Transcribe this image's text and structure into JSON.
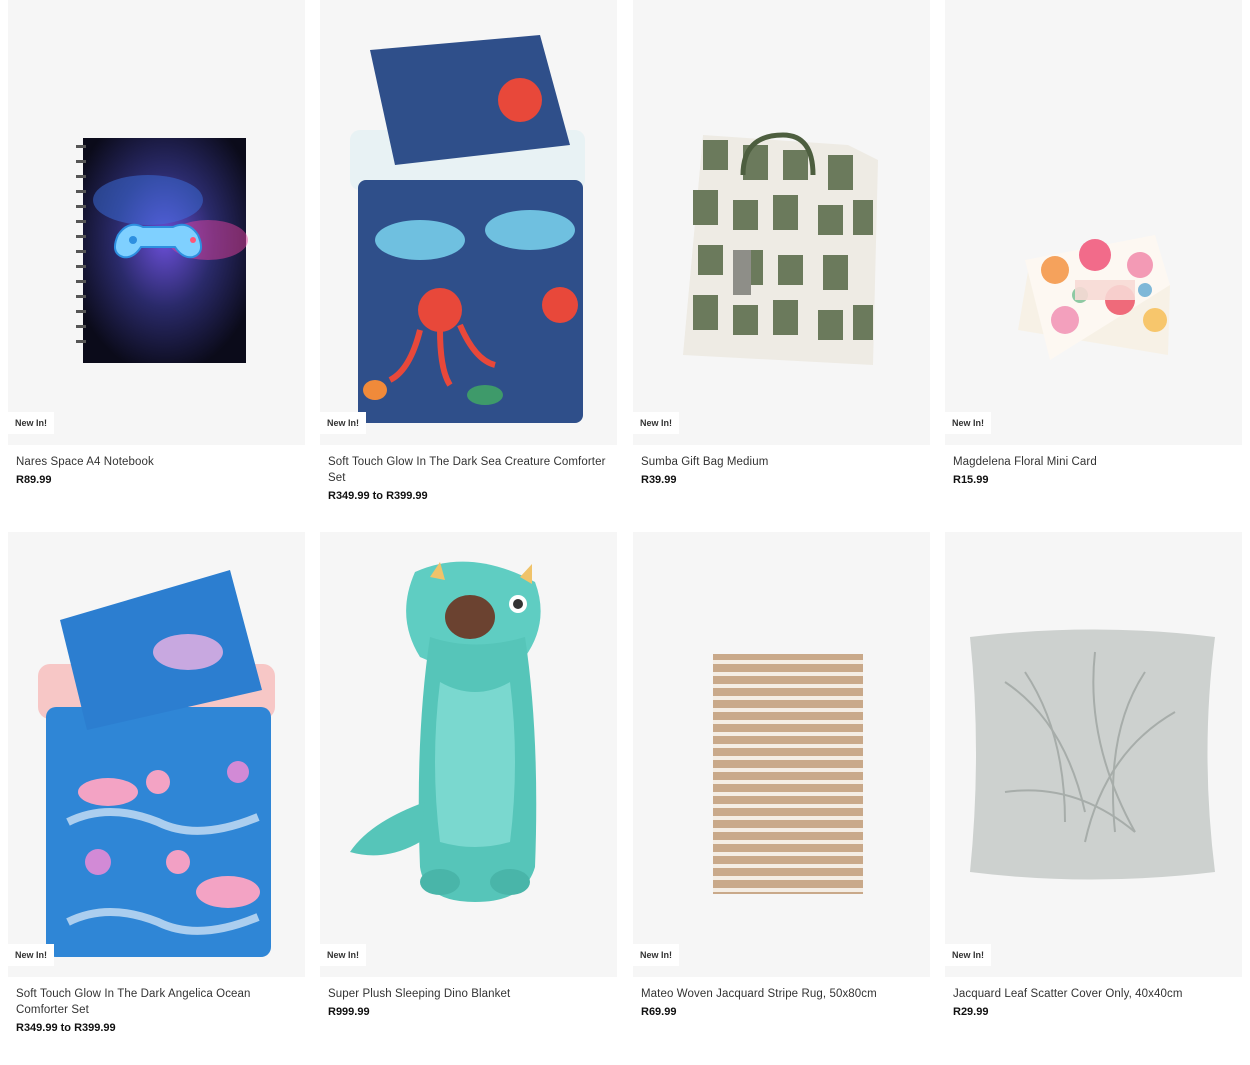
{
  "badge_label": "New In!",
  "products": [
    {
      "name": "Nares Space A4 Notebook",
      "price": "R89.99",
      "image": "space-notebook"
    },
    {
      "name": "Soft Touch Glow In The Dark Sea Creature Comforter Set",
      "price": "R349.99 to R399.99",
      "image": "sea-creature-comforter"
    },
    {
      "name": "Sumba Gift Bag Medium",
      "price": "R39.99",
      "image": "gift-bag"
    },
    {
      "name": "Magdelena Floral Mini Card",
      "price": "R15.99",
      "image": "floral-card"
    },
    {
      "name": "Soft Touch Glow In The Dark Angelica Ocean Comforter Set",
      "price": "R349.99 to R399.99",
      "image": "ocean-comforter"
    },
    {
      "name": "Super Plush Sleeping Dino Blanket",
      "price": "R999.99",
      "image": "dino-blanket"
    },
    {
      "name": "Mateo Woven Jacquard Stripe Rug, 50x80cm",
      "price": "R69.99",
      "image": "stripe-rug"
    },
    {
      "name": "Jacquard Leaf Scatter Cover Only, 40x40cm",
      "price": "R29.99",
      "image": "leaf-cushion"
    }
  ],
  "colors": {
    "image_bg": "#f6f6f6",
    "text": "#333333",
    "price": "#111111"
  }
}
